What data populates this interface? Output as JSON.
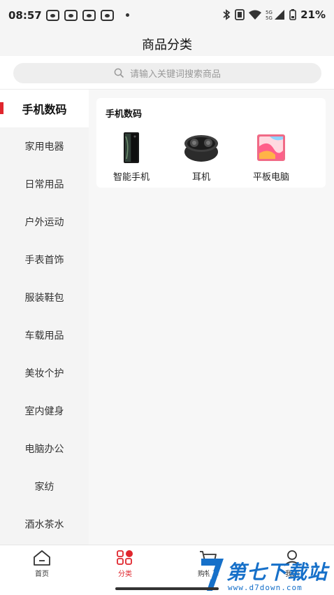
{
  "status_bar": {
    "time": "08:57",
    "battery": "21%",
    "notification_icons": [
      "paw-notification-icon",
      "paw-notification-icon",
      "paw-notification-icon",
      "paw-notification-icon"
    ],
    "indicators": [
      "bluetooth-icon",
      "nfc-icon",
      "wifi-icon",
      "signal-5g-icon",
      "battery-icon"
    ]
  },
  "header": {
    "title": "商品分类"
  },
  "search": {
    "placeholder": "请输入关键词搜索商品",
    "icon": "search-icon"
  },
  "sidebar": {
    "items": [
      {
        "label": "手机数码",
        "active": true
      },
      {
        "label": "家用电器"
      },
      {
        "label": "日常用品"
      },
      {
        "label": "户外运动"
      },
      {
        "label": "手表首饰"
      },
      {
        "label": "服装鞋包"
      },
      {
        "label": "车载用品"
      },
      {
        "label": "美妆个护"
      },
      {
        "label": "室内健身"
      },
      {
        "label": "电脑办公"
      },
      {
        "label": "家纺"
      },
      {
        "label": "酒水茶水"
      }
    ]
  },
  "content": {
    "section_title": "手机数码",
    "products": [
      {
        "label": "智能手机",
        "icon": "foldable-phone-icon"
      },
      {
        "label": "耳机",
        "icon": "earbuds-case-icon"
      },
      {
        "label": "平板电脑",
        "icon": "tablet-icon"
      }
    ]
  },
  "tab_bar": {
    "tabs": [
      {
        "label": "首页",
        "icon": "home-icon"
      },
      {
        "label": "分类",
        "icon": "category-icon",
        "active": true
      },
      {
        "label": "购物车",
        "icon": "cart-icon"
      },
      {
        "label": "我的",
        "icon": "user-icon"
      }
    ]
  },
  "watermark": {
    "text": "第七下载站",
    "url": "www.d7down.com"
  },
  "colors": {
    "accent": "#e0262d",
    "watermark": "#1670c9",
    "background": "#f7f7f7"
  }
}
